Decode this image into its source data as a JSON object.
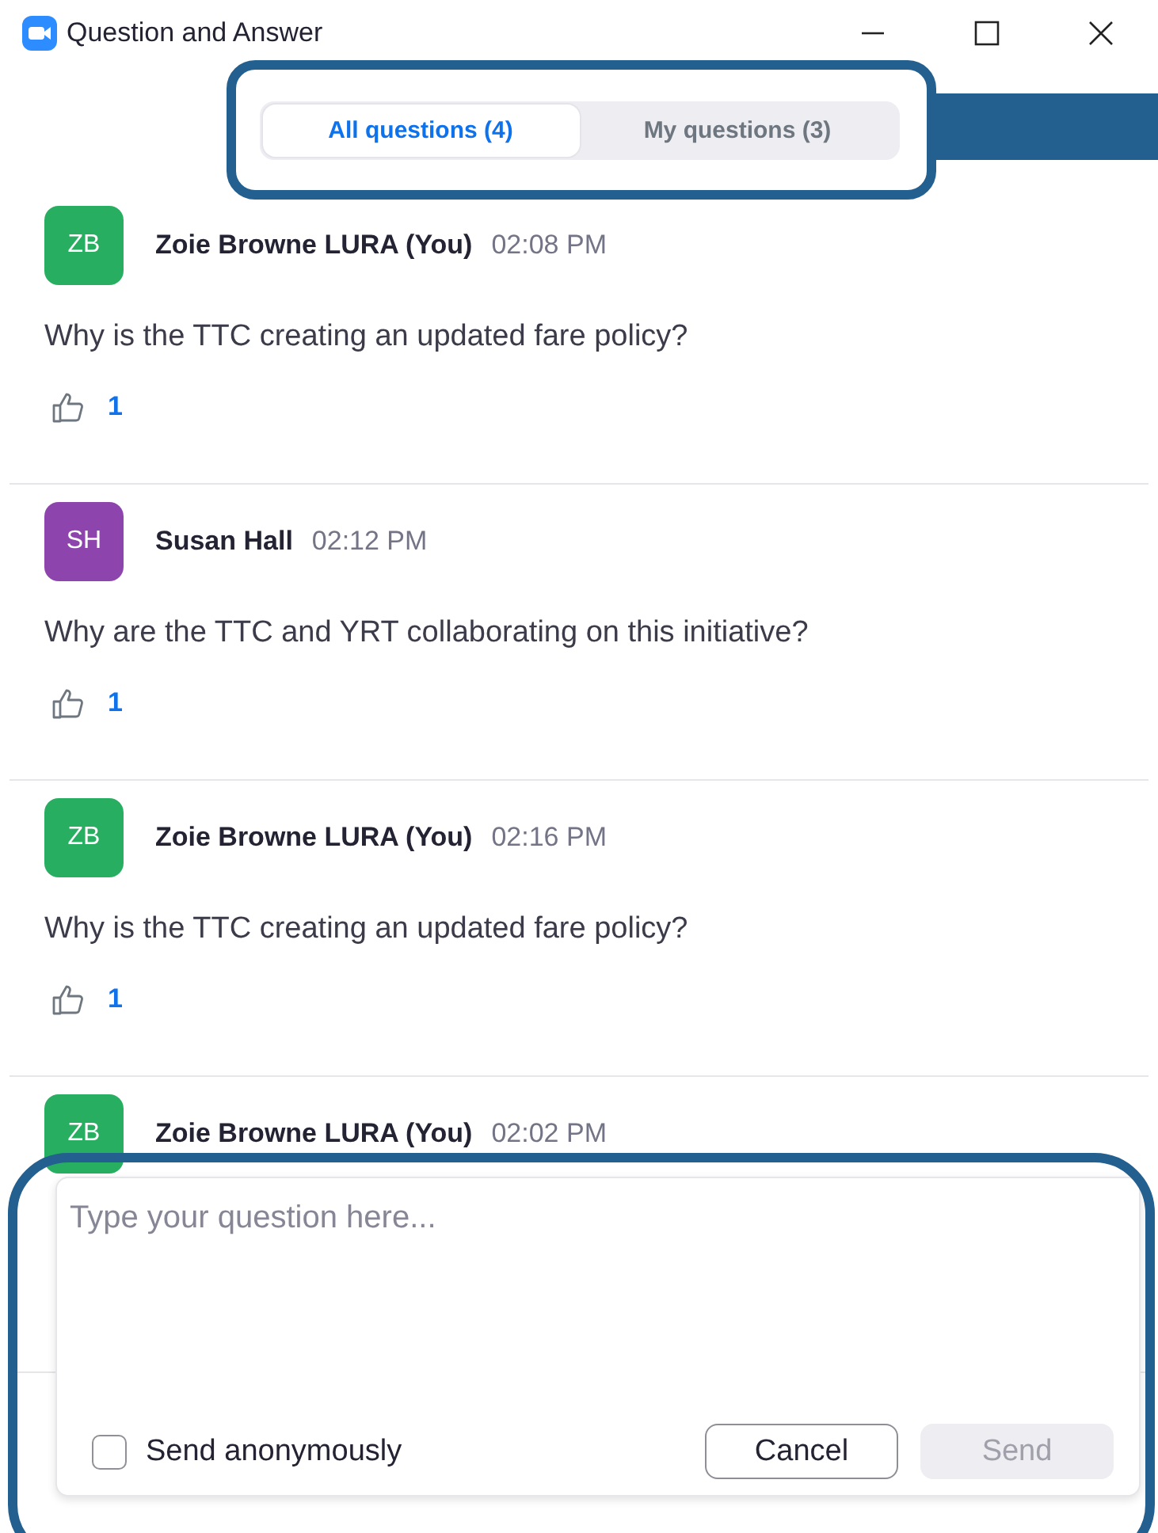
{
  "window": {
    "title": "Question and Answer"
  },
  "tabs": [
    {
      "label": "All questions (4)",
      "selected": true
    },
    {
      "label": "My questions (3)",
      "selected": false
    }
  ],
  "questions": [
    {
      "initials": "ZB",
      "color": "#27ae60",
      "author": "Zoie Browne LURA (You)",
      "time": "02:08 PM",
      "text": "Why is the TTC creating an updated fare policy?",
      "likes": "1"
    },
    {
      "initials": "SH",
      "color": "#8e44ad",
      "author": "Susan Hall",
      "time": "02:12 PM",
      "text": "Why are the TTC and YRT collaborating on this initiative?",
      "likes": "1"
    },
    {
      "initials": "ZB",
      "color": "#27ae60",
      "author": "Zoie Browne LURA (You)",
      "time": "02:16 PM",
      "text": "Why is the TTC creating an updated fare policy?",
      "likes": "1"
    },
    {
      "initials": "ZB",
      "color": "#27ae60",
      "author": "Zoie Browne LURA (You)",
      "time": "02:02 PM"
    }
  ],
  "composer": {
    "placeholder": "Type your question here...",
    "anonymous": {
      "label": "Send anonymously",
      "checked": false
    },
    "buttons": [
      {
        "label": "Cancel",
        "disabled": false
      },
      {
        "label": "Send",
        "disabled": true
      }
    ]
  }
}
